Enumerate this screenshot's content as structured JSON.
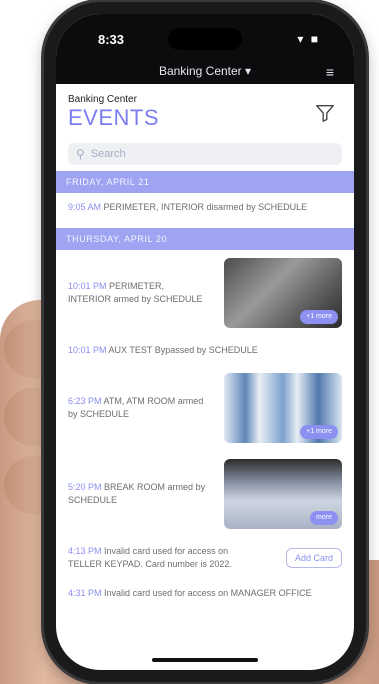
{
  "status": {
    "time": "8:33",
    "icons": "▾ ■"
  },
  "header": {
    "app_title": "Banking Center ▾",
    "menu_icon": "≡"
  },
  "page": {
    "subtitle": "Banking Center",
    "title": "EVENTS"
  },
  "search": {
    "placeholder": "Search"
  },
  "groups": [
    {
      "day": "FRIDAY, APRIL 21",
      "events": [
        {
          "time": "9:05 AM",
          "text": "PERIMETER, INTERIOR disarmed by SCHEDULE"
        }
      ]
    },
    {
      "day": "THURSDAY, APRIL 20",
      "events": [
        {
          "time": "10:01 PM",
          "text": "PERIMETER, INTERIOR armed by SCHEDULE",
          "more": "+1 more"
        },
        {
          "time": "10:01 PM",
          "text": "AUX TEST Bypassed by SCHEDULE"
        },
        {
          "time": "6:23 PM",
          "text": "ATM, ATM ROOM armed by SCHEDULE",
          "more": "+1 more"
        },
        {
          "time": "5:20 PM",
          "text": "BREAK ROOM armed by SCHEDULE",
          "more": "more"
        },
        {
          "time": "4:13 PM",
          "text": "Invalid card used for access on TELLER KEYPAD. Card number is 2022.",
          "action": "Add Card"
        },
        {
          "time": "4:31 PM",
          "text": "Invalid card used for access on MANAGER OFFICE"
        }
      ]
    }
  ]
}
